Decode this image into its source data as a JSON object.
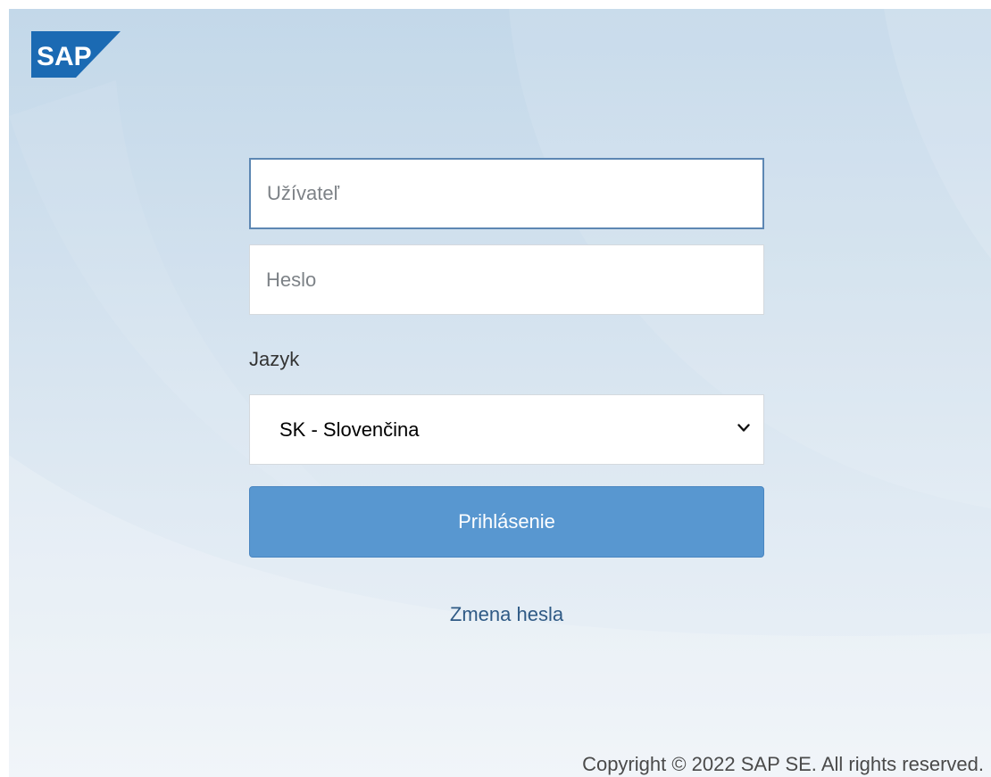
{
  "brand": {
    "logo_text": "SAP",
    "logo_color": "#1b6ab3"
  },
  "login_form": {
    "username_placeholder": "Užívateľ",
    "password_placeholder": "Heslo",
    "language_label": "Jazyk",
    "language_selected": "SK - Slovenčina",
    "login_button_label": "Prihlásenie",
    "change_password_link": "Zmena hesla"
  },
  "footer": {
    "copyright": "Copyright © 2022 SAP SE. All rights reserved."
  },
  "colors": {
    "accent": "#5897d0",
    "focus_border": "#5d87b3",
    "link": "#2f5a85"
  },
  "icons": {
    "select_arrow": "chevron-down-icon"
  }
}
